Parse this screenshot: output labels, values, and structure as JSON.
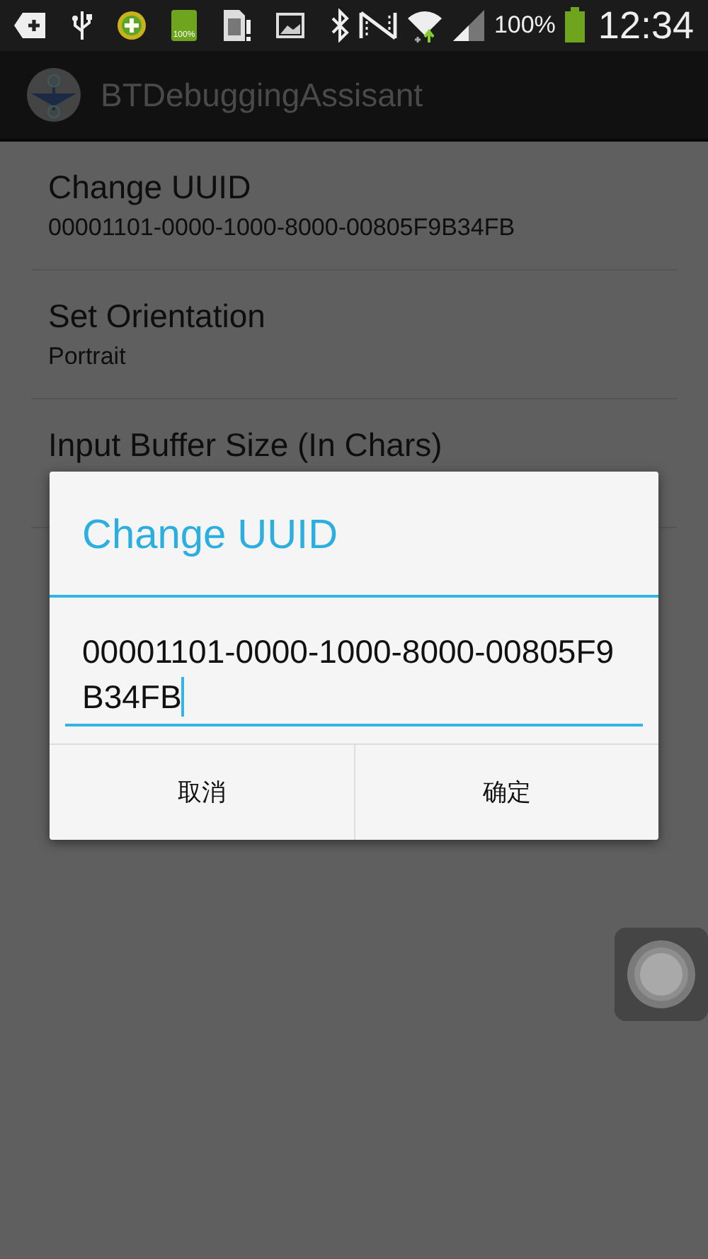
{
  "status_bar": {
    "battery_notification_label": "100%",
    "battery_percent": "100%",
    "time": "12:34"
  },
  "action_bar": {
    "title": "BTDebuggingAssisant"
  },
  "preferences": [
    {
      "title": "Change UUID",
      "summary": "00001101-0000-1000-8000-00805F9B34FB"
    },
    {
      "title": "Set Orientation",
      "summary": "Portrait"
    },
    {
      "title": "Input Buffer Size (In Chars)"
    }
  ],
  "dialog": {
    "title": "Change UUID",
    "value": "00001101-0000-1000-8000-00805F9B34FB",
    "buttons": [
      "取消",
      "确定"
    ]
  }
}
